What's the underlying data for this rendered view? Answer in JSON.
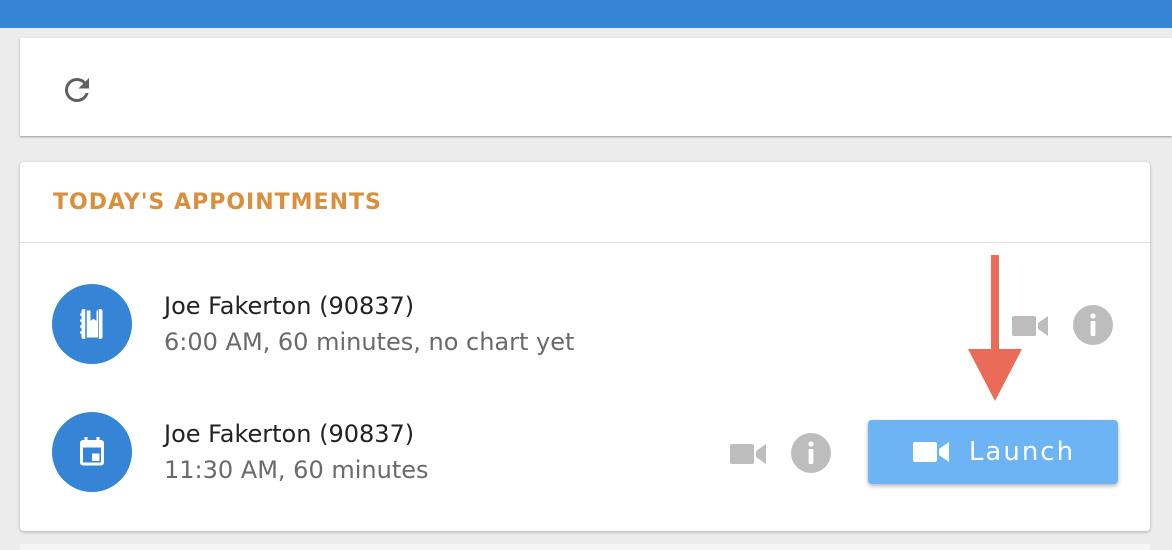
{
  "toolbar": {
    "refresh_icon": "refresh-icon"
  },
  "appointments": {
    "title": "TODAY'S APPOINTMENTS",
    "items": [
      {
        "icon": "notebook-icon",
        "name": "Joe Fakerton (90837)",
        "detail": "6:00 AM, 60 minutes, no chart yet"
      },
      {
        "icon": "calendar-icon",
        "name": "Joe Fakerton (90837)",
        "detail": "11:30 AM, 60 minutes"
      }
    ],
    "launch_label": "Launch"
  },
  "colors": {
    "topbar": "#3584d6",
    "title": "#d98f3b",
    "avatar": "#3584d6",
    "launch": "#6cb4f3",
    "arrow": "#ea6b58",
    "icon_gray": "#bdbdbd"
  }
}
